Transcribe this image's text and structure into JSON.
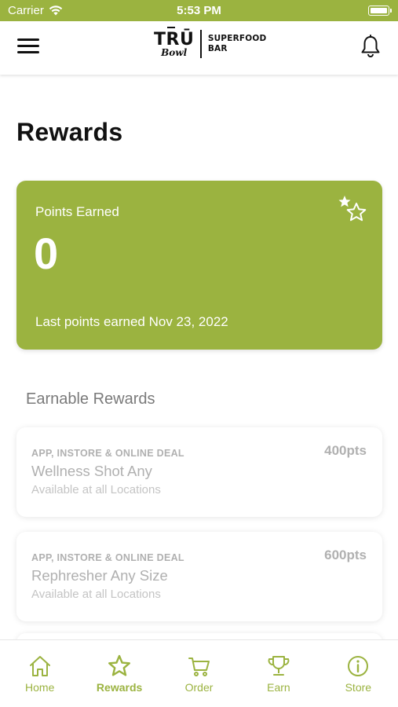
{
  "status_bar": {
    "carrier": "Carrier",
    "time": "5:53 PM",
    "battery_level": 1.0
  },
  "header": {
    "logo_brand": "TRŪ",
    "logo_script": "Bowl",
    "logo_line1": "SUPERFOOD",
    "logo_line2": "BAR",
    "menu_icon": "hamburger-icon",
    "notification_icon": "bell-icon"
  },
  "page": {
    "title": "Rewards"
  },
  "points_card": {
    "label": "Points Earned",
    "value": "0",
    "last_earned": "Last points earned Nov 23, 2022",
    "icon": "stars-icon",
    "color": "#9bb340"
  },
  "earnable": {
    "title": "Earnable Rewards",
    "rewards": [
      {
        "type": "APP, INSTORE & ONLINE DEAL",
        "name": "Wellness Shot Any",
        "availability": "Available at all Locations",
        "points": "400pts"
      },
      {
        "type": "APP, INSTORE & ONLINE DEAL",
        "name": "Rephresher Any Size",
        "availability": "Available at all Locations",
        "points": "600pts"
      }
    ]
  },
  "tab_bar": {
    "tabs": [
      {
        "label": "Home",
        "icon": "home-icon",
        "active": false
      },
      {
        "label": "Rewards",
        "icon": "star-icon",
        "active": true
      },
      {
        "label": "Order",
        "icon": "cart-icon",
        "active": false
      },
      {
        "label": "Earn",
        "icon": "trophy-icon",
        "active": false
      },
      {
        "label": "Store",
        "icon": "info-icon",
        "active": false
      }
    ],
    "accent": "#9bb340"
  }
}
